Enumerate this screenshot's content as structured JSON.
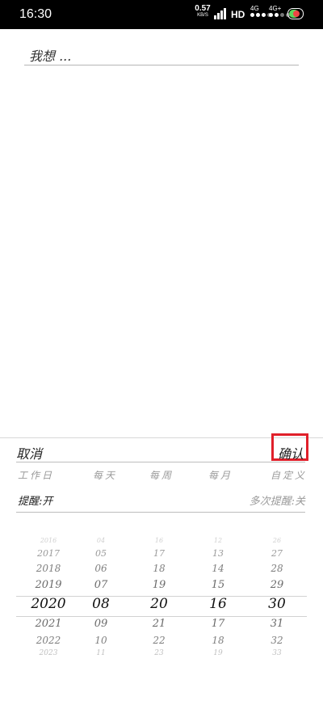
{
  "status_bar": {
    "time": "16:30",
    "speed_value": "0.57",
    "speed_unit": "KB/S",
    "hd": "HD",
    "net1": "4G",
    "net2": "4G+"
  },
  "wish_input": {
    "placeholder": "我想 ..."
  },
  "sheet": {
    "cancel": "取消",
    "confirm": "确认",
    "frequency": [
      "工作日",
      "每天",
      "每周",
      "每月",
      "自定义"
    ],
    "remind": "提醒:开",
    "multi_remind": "多次提醒:关"
  },
  "picker": {
    "years": [
      "2016",
      "2017",
      "2018",
      "2019",
      "2020",
      "2021",
      "2022",
      "2023"
    ],
    "months": [
      "04",
      "05",
      "06",
      "07",
      "08",
      "09",
      "10",
      "11"
    ],
    "days": [
      "16",
      "17",
      "18",
      "19",
      "20",
      "21",
      "22",
      "23"
    ],
    "hours": [
      "12",
      "13",
      "14",
      "15",
      "16",
      "17",
      "18",
      "19"
    ],
    "minutes": [
      "26",
      "27",
      "28",
      "29",
      "30",
      "31",
      "32",
      "33"
    ],
    "selected_index": 4
  },
  "colors": {
    "accent": "#e0202a"
  }
}
